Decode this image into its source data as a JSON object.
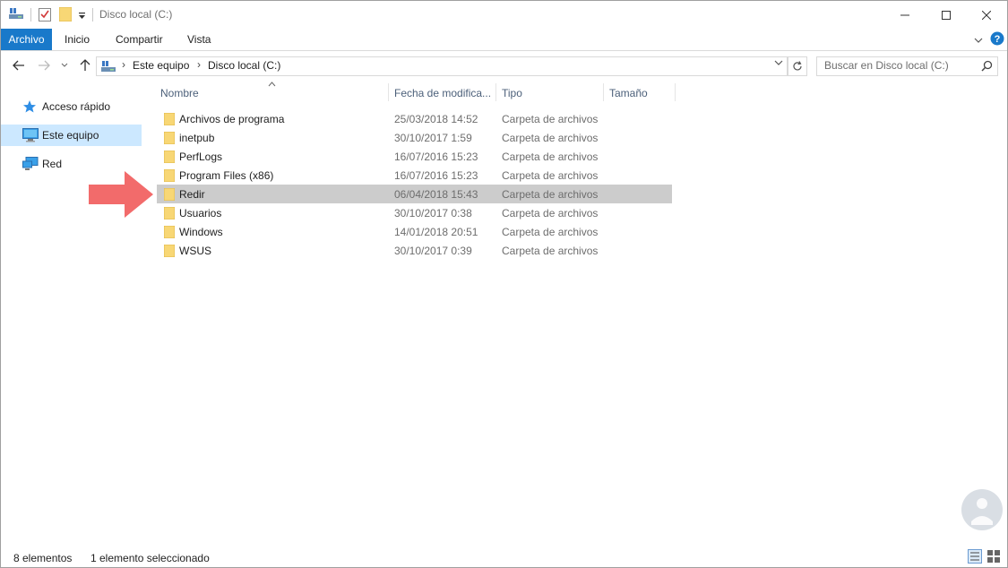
{
  "window": {
    "title": "Disco local (C:)",
    "controls": {
      "minimize": "—",
      "maximize": "☐",
      "close": "✕"
    }
  },
  "ribbon": {
    "tabs": [
      {
        "label": "Archivo",
        "active": true
      },
      {
        "label": "Inicio"
      },
      {
        "label": "Compartir"
      },
      {
        "label": "Vista"
      }
    ]
  },
  "address": {
    "breadcrumbs": [
      "Este equipo",
      "Disco local (C:)"
    ]
  },
  "search": {
    "placeholder": "Buscar en Disco local (C:)"
  },
  "nav": {
    "items": [
      {
        "label": "Acceso rápido",
        "icon": "star-icon"
      },
      {
        "label": "Este equipo",
        "icon": "computer-icon",
        "selected": true
      },
      {
        "label": "Red",
        "icon": "network-icon"
      }
    ]
  },
  "columns": {
    "name": "Nombre",
    "date": "Fecha de modifica...",
    "type": "Tipo",
    "size": "Tamaño"
  },
  "files": [
    {
      "name": "Archivos de programa",
      "date": "25/03/2018 14:52",
      "type": "Carpeta de archivos"
    },
    {
      "name": "inetpub",
      "date": "30/10/2017 1:59",
      "type": "Carpeta de archivos"
    },
    {
      "name": "PerfLogs",
      "date": "16/07/2016 15:23",
      "type": "Carpeta de archivos"
    },
    {
      "name": "Program Files (x86)",
      "date": "16/07/2016 15:23",
      "type": "Carpeta de archivos"
    },
    {
      "name": "Redir",
      "date": "06/04/2018 15:43",
      "type": "Carpeta de archivos",
      "selected": true
    },
    {
      "name": "Usuarios",
      "date": "30/10/2017 0:38",
      "type": "Carpeta de archivos"
    },
    {
      "name": "Windows",
      "date": "14/01/2018 20:51",
      "type": "Carpeta de archivos"
    },
    {
      "name": "WSUS",
      "date": "30/10/2017 0:39",
      "type": "Carpeta de archivos"
    }
  ],
  "status": {
    "count": "8 elementos",
    "selection": "1 elemento seleccionado"
  },
  "colors": {
    "accent": "#1979ca",
    "selected_nav": "#cce8ff",
    "selected_row": "#cccccc",
    "annotation_arrow": "#f26b6b",
    "folder": "#f6d365"
  }
}
